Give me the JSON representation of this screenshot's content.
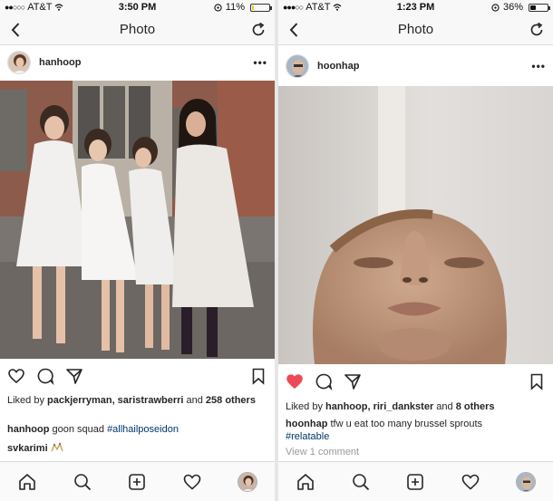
{
  "left": {
    "status": {
      "carrier": "AT&T",
      "time": "3:50 PM",
      "battery": "11%",
      "battery_level": 0.11,
      "battery_color": "#f5c518"
    },
    "nav": {
      "title": "Photo",
      "back_icon": "chevron-left-icon",
      "refresh_icon": "refresh-icon"
    },
    "post": {
      "username": "hanhoop",
      "more": "•••",
      "liked_by_prefix": "Liked by ",
      "liked_names": "packjerryman, saristrawberri",
      "liked_and": " and ",
      "liked_count": "258 others",
      "caption_user": "hanhoop",
      "caption_text": " goon squad ",
      "caption_hashtag": "#allhailposeidon",
      "comment_user": "svkarimi",
      "liked": false
    }
  },
  "right": {
    "status": {
      "carrier": "AT&T",
      "time": "1:23 PM",
      "battery": "36%",
      "battery_level": 0.36,
      "battery_color": "#111111"
    },
    "nav": {
      "title": "Photo",
      "back_icon": "chevron-left-icon",
      "refresh_icon": "refresh-icon"
    },
    "post": {
      "username": "hoonhap",
      "more": "•••",
      "liked_by_prefix": "Liked by ",
      "liked_names": "hanhoop, riri_dankster",
      "liked_and": " and ",
      "liked_count": "8 others",
      "caption_user": "hoonhap",
      "caption_text": " tfw u eat too many brussel sprouts",
      "caption_hashtag": "#relatable",
      "view_comments": "View 1 comment",
      "liked": true
    }
  },
  "colors": {
    "like_red": "#ed4956",
    "hashtag_blue": "#003569",
    "muted_gray": "#999999",
    "border_gray": "#dbdbdb"
  },
  "tabs": [
    "home-icon",
    "search-icon",
    "add-icon",
    "heart-icon",
    "profile-avatar"
  ]
}
